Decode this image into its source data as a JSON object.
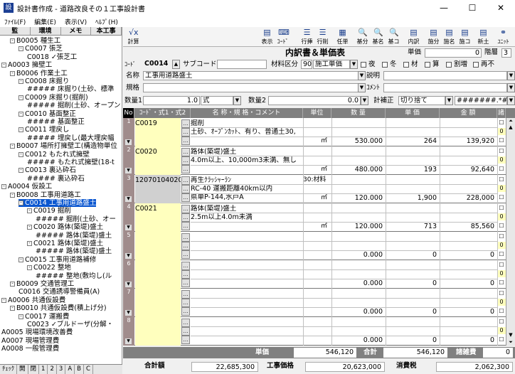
{
  "window": {
    "title": "設計書作成 - 道路改良その１工事設計書",
    "minimize": "—",
    "maximize": "☐",
    "close": "✕"
  },
  "menu": [
    "ﾌｧｲﾙ(F)",
    "編集(E)",
    "表示(V)",
    "ﾍﾙﾌﾟ(H)"
  ],
  "tree_tabs": [
    "監",
    "環境",
    "メモ",
    "本工事"
  ],
  "tree": [
    {
      "text": "B0005 種生工",
      "level": 2,
      "exp": "-"
    },
    {
      "text": "C0007 張芝",
      "level": 3,
      "exp": "-"
    },
    {
      "text": "C0018 ✓張芝工",
      "level": 4,
      "exp": ""
    },
    {
      "text": "A0003 擁壁工",
      "level": 1,
      "exp": "-"
    },
    {
      "text": "B0006 作業土工",
      "level": 2,
      "exp": "-"
    },
    {
      "text": "C0008 床掘り",
      "level": 3,
      "exp": "-"
    },
    {
      "text": "##### 床掘り(土砂、標準",
      "level": 4,
      "exp": ""
    },
    {
      "text": "C0009 床掘り(掘削)",
      "level": 3,
      "exp": "-"
    },
    {
      "text": "##### 掘削(土砂、オープン",
      "level": 4,
      "exp": ""
    },
    {
      "text": "C0010 基面整正",
      "level": 3,
      "exp": "-"
    },
    {
      "text": "##### 基面整正",
      "level": 4,
      "exp": ""
    },
    {
      "text": "C0011 埋戻し",
      "level": 3,
      "exp": "-"
    },
    {
      "text": "##### 埋戻し(最大埋戻幅",
      "level": 4,
      "exp": ""
    },
    {
      "text": "B0007 場所打擁壁工(構造物単位",
      "level": 2,
      "exp": "-"
    },
    {
      "text": "C0012 もたれ式擁壁",
      "level": 3,
      "exp": "-"
    },
    {
      "text": "##### もたれ式擁壁(18-t",
      "level": 4,
      "exp": ""
    },
    {
      "text": "C0013 裏込砕石",
      "level": 3,
      "exp": "-"
    },
    {
      "text": "##### 裏込砕石",
      "level": 4,
      "exp": ""
    },
    {
      "text": "A0004 仮設工",
      "level": 1,
      "exp": "-"
    },
    {
      "text": "B0008 工事用道路工",
      "level": 2,
      "exp": "-"
    },
    {
      "text": "C0014 工事用道路盛土",
      "level": 3,
      "exp": "-",
      "selected": true
    },
    {
      "text": "C0019 掘削",
      "level": 4,
      "exp": "-"
    },
    {
      "text": "##### 掘削(土砂、オー",
      "level": 5,
      "exp": ""
    },
    {
      "text": "C0020 路体(築堤)盛土",
      "level": 4,
      "exp": "-"
    },
    {
      "text": "##### 路体(築堤)盛土",
      "level": 5,
      "exp": ""
    },
    {
      "text": "C0021 路体(築堤)盛土",
      "level": 4,
      "exp": "-"
    },
    {
      "text": "##### 路体(築堤)盛土",
      "level": 5,
      "exp": ""
    },
    {
      "text": "C0015 工事用道路補修",
      "level": 3,
      "exp": "-"
    },
    {
      "text": "C0022 整地",
      "level": 4,
      "exp": "-"
    },
    {
      "text": "##### 整地(敷均し(ル",
      "level": 5,
      "exp": ""
    },
    {
      "text": "B0009 交通管理工",
      "level": 2,
      "exp": "-"
    },
    {
      "text": "C0016 交通誘導警備員(A)",
      "level": 3,
      "exp": ""
    },
    {
      "text": "A0006 共通仮設費",
      "level": 1,
      "exp": "-"
    },
    {
      "text": "B0010 共通仮設費(積上げ分)",
      "level": 2,
      "exp": "-"
    },
    {
      "text": "C0017 運搬費",
      "level": 3,
      "exp": "-"
    },
    {
      "text": "C0023 ✓ブルドーザ(分解・",
      "level": 4,
      "exp": ""
    },
    {
      "text": "A0005 現場環境改善費",
      "level": 1,
      "exp": ""
    },
    {
      "text": "A0007 現場管理費",
      "level": 1,
      "exp": ""
    },
    {
      "text": "A0008 一般管理費",
      "level": 1,
      "exp": ""
    }
  ],
  "tree_bottom": [
    "ﾁｪｯｸ",
    "開",
    "閉",
    "1",
    "2",
    "3",
    "A",
    "B",
    "C"
  ],
  "toolbar": [
    {
      "label": "計算",
      "icon": "√x"
    },
    {
      "label": "表示",
      "icon": "▤"
    },
    {
      "label": "ｺｰﾄﾞ",
      "icon": "⌨"
    },
    {
      "label": "行挿",
      "icon": "☰"
    },
    {
      "label": "行削",
      "icon": "☰"
    },
    {
      "label": "任単",
      "icon": "▦"
    },
    {
      "label": "基分",
      "icon": "🔍"
    },
    {
      "label": "基名",
      "icon": "🔍"
    },
    {
      "label": "基コ",
      "icon": "🔍"
    },
    {
      "label": "内訳",
      "icon": "▤"
    },
    {
      "label": "施分",
      "icon": "▤"
    },
    {
      "label": "施名",
      "icon": "▤"
    },
    {
      "label": "施コ",
      "icon": "▤"
    },
    {
      "label": "新土",
      "icon": "▤"
    },
    {
      "label": "ﾕﾆｯﾄ",
      "icon": "⚭"
    }
  ],
  "form": {
    "heading": "内訳書＆単価表",
    "unit_label": "単価",
    "unit_value": "0",
    "level_label": "階層",
    "level_value": "3",
    "code_label": "ｺｰﾄﾞ",
    "code": "C0014",
    "subcode_label": "サブコード",
    "material_label": "材料区分",
    "material_value": "90",
    "material_name": "施工単価",
    "checks": [
      "夜",
      "冬",
      "材",
      "算",
      "割増",
      "再不"
    ],
    "name_label": "名称",
    "name": "工事用道路盛土",
    "desc_label": "説明",
    "spec_label": "規格",
    "comment_label": "ｺﾒﾝﾄ",
    "qty1_label": "数量1",
    "qty1": "1.0",
    "qty1_unit": "式",
    "qty2_label": "数量2",
    "qty2": "0.0",
    "calc_label": "計補正",
    "calc_value": "切り捨て",
    "fmt_value": "#######.*###"
  },
  "grid_headers": [
    "No",
    "ｺｰﾄﾞ・式1・式2",
    "名 称・規 格・コメント",
    "単位",
    "数 量",
    "単 価",
    "金 額",
    "諸"
  ],
  "rows": [
    {
      "no": "1",
      "code": "C0019",
      "lines": [
        "掘削",
        "土砂、ｵｰﾌﾟﾝｶｯﾄ、有り、普通土30,",
        ""
      ],
      "unit": "㎥",
      "qty": "530.000",
      "price": "264",
      "amount": "139,920",
      "flag": "0",
      "gray": false
    },
    {
      "no": "2",
      "code": "C0020",
      "lines": [
        "路体(築堤)盛土",
        "4.0m以上、10,000m3未満、無し",
        ""
      ],
      "unit": "㎥",
      "qty": "480.000",
      "price": "193",
      "amount": "92,640",
      "flag": "0",
      "gray": false
    },
    {
      "no": "3",
      "code": "12070104020",
      "lines": [
        "再生ｸﾗｯｼｬｰﾗﾝ",
        "RC-40 運搬距離40km以内",
        "県単P-144,水戸A"
      ],
      "unit2": "30:材料",
      "unit": "㎥",
      "qty": "120.000",
      "price": "1,900",
      "amount": "228,000",
      "flag": "0",
      "gray": true
    },
    {
      "no": "4",
      "code": "C0021",
      "lines": [
        "路体(築堤)盛土",
        "2.5m以上4.0m未満",
        ""
      ],
      "unit": "㎥",
      "qty": "120.000",
      "price": "713",
      "amount": "85,560",
      "flag": "0",
      "gray": false
    },
    {
      "no": "5",
      "code": "",
      "lines": [
        "",
        "",
        ""
      ],
      "unit": "",
      "qty": "0.000",
      "price": "0",
      "amount": "0",
      "flag": "0",
      "gray": false
    },
    {
      "no": "6",
      "code": "",
      "lines": [
        "",
        "",
        ""
      ],
      "unit": "",
      "qty": "0.000",
      "price": "0",
      "amount": "0",
      "flag": "0",
      "gray": false
    },
    {
      "no": "7",
      "code": "",
      "lines": [
        "",
        "",
        ""
      ],
      "unit": "",
      "qty": "0.000",
      "price": "0",
      "amount": "0",
      "flag": "0",
      "gray": false
    },
    {
      "no": "8",
      "code": "",
      "lines": [
        "",
        "",
        ""
      ],
      "unit": "",
      "qty": "0.000",
      "price": "0",
      "amount": "0",
      "flag": "0",
      "gray": false
    }
  ],
  "summary": {
    "unit_label": "単価",
    "unit_value": "546,120",
    "total_label": "合計",
    "total_value": "546,120",
    "misc_label": "諸雑費",
    "misc_value": "0"
  },
  "totals": {
    "sum_label": "合計額",
    "sum_value": "22,685,300",
    "work_label": "工事価格",
    "work_value": "20,623,000",
    "tax_label": "消費税",
    "tax_value": "2,062,300"
  }
}
